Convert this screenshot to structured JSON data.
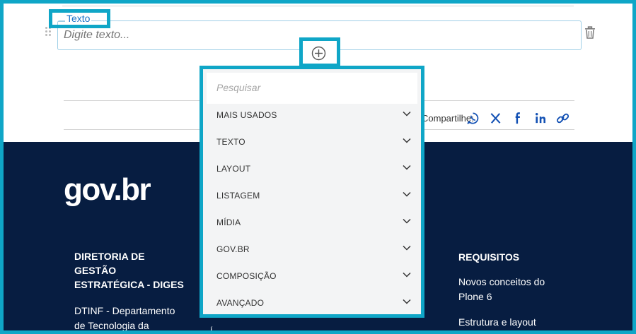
{
  "field": {
    "legend": "Texto",
    "placeholder": "Digite texto..."
  },
  "add_block": {
    "icon": "plus-circle-icon"
  },
  "share": {
    "label": "Compartilhe:",
    "icons": [
      "whatsapp-icon",
      "x-icon",
      "facebook-icon",
      "linkedin-icon",
      "link-icon"
    ]
  },
  "block_chooser": {
    "search_placeholder": "Pesquisar",
    "items": [
      {
        "label": "MAIS USADOS"
      },
      {
        "label": "TEXTO"
      },
      {
        "label": "LAYOUT"
      },
      {
        "label": "LISTAGEM"
      },
      {
        "label": "MÍDIA"
      },
      {
        "label": "GOV.BR"
      },
      {
        "label": "COMPOSIÇÃO"
      },
      {
        "label": "AVANÇADO"
      }
    ]
  },
  "footer": {
    "logo": "gov.br",
    "col1": {
      "title": "DIRETORIA DE GESTÃO ESTRATÉGICA - DIGES",
      "title_lines": [
        "DIRETORIA DE",
        "GESTÃO",
        "ESTRATÉGICA - DIGES"
      ],
      "link_lines": [
        "DTINF - Departamento",
        "de Tecnologia da"
      ]
    },
    "col3": {
      "title": "REQUISITOS",
      "links": [
        {
          "lines": [
            "Novos conceitos do",
            "Plone 6"
          ]
        },
        {
          "lines": [
            "Estrutura e layout"
          ]
        }
      ]
    },
    "partial_glyph": "Í"
  },
  "colors": {
    "highlight": "#0fa6c7",
    "footer_bg": "#071d41",
    "link_blue": "#1351b4",
    "dropdown_bg": "#f3f4f5"
  }
}
